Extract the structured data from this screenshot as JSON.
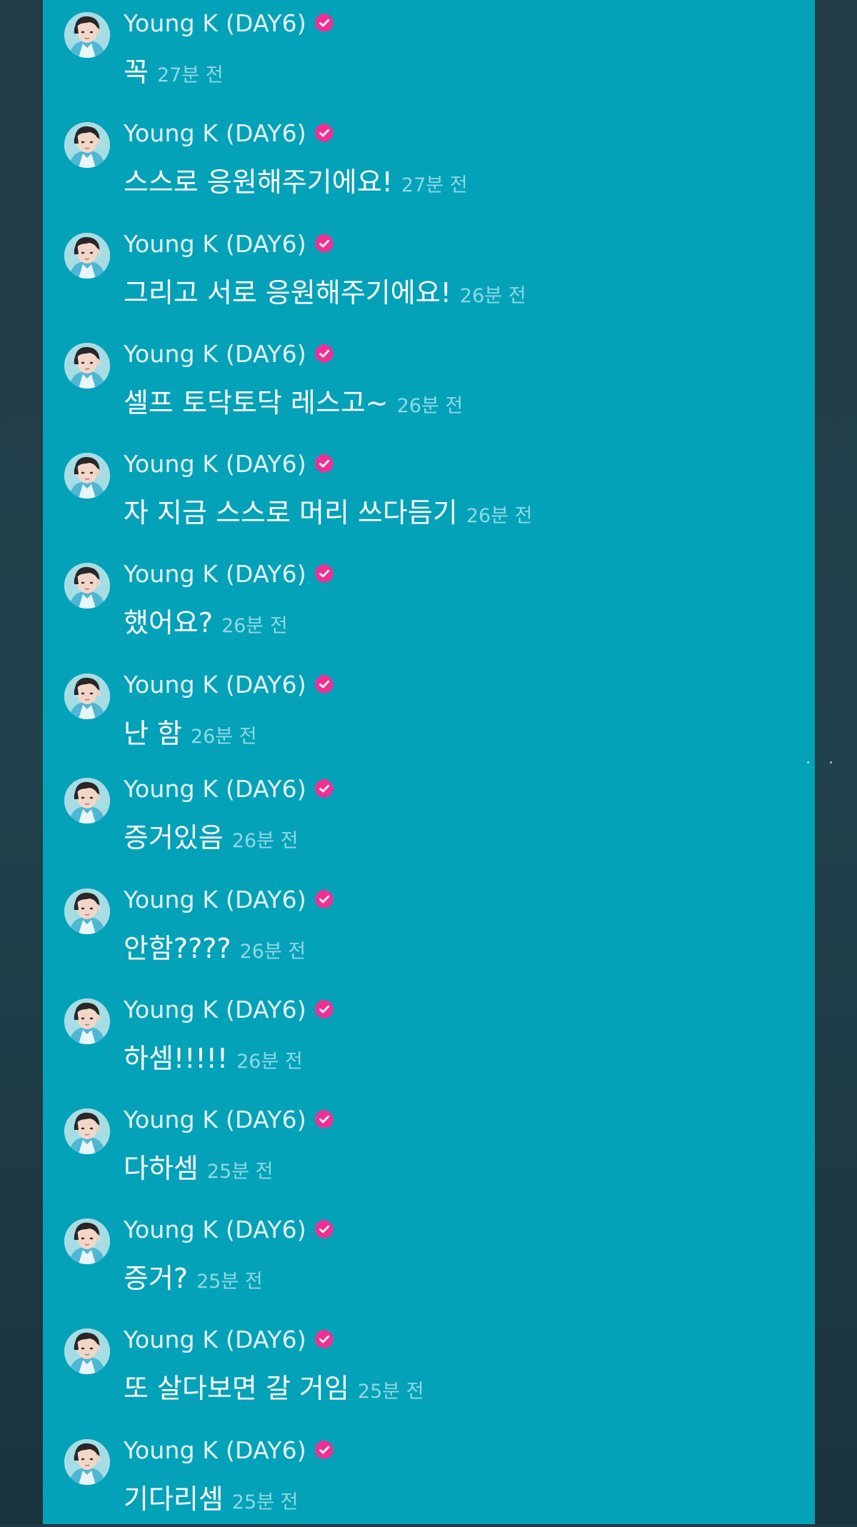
{
  "colors": {
    "panel": "#04a2b9",
    "badge": "#f12f93",
    "name_text": "#e3f4f7",
    "message_text": "#ffffff",
    "time_text": "#8fd8e3"
  },
  "badge_icon": "verified-check-icon",
  "messages": [
    {
      "name": "Young K (DAY6)",
      "text": "꼭",
      "time": "27분 전"
    },
    {
      "name": "Young K (DAY6)",
      "text": "스스로 응원해주기에요!",
      "time": "27분 전"
    },
    {
      "name": "Young K (DAY6)",
      "text": "그리고 서로 응원해주기에요!",
      "time": "26분 전"
    },
    {
      "name": "Young K (DAY6)",
      "text": "셀프 토닥토닥 레스고~",
      "time": "26분 전"
    },
    {
      "name": "Young K (DAY6)",
      "text": "자 지금 스스로 머리 쓰다듬기",
      "time": "26분 전"
    },
    {
      "name": "Young K (DAY6)",
      "text": "했어요?",
      "time": "26분 전"
    },
    {
      "name": "Young K (DAY6)",
      "text": "난 함",
      "time": "26분 전"
    },
    {
      "name": "Young K (DAY6)",
      "text": "증거있음",
      "time": "26분 전"
    },
    {
      "name": "Young K (DAY6)",
      "text": "안함????",
      "time": "26분 전"
    },
    {
      "name": "Young K (DAY6)",
      "text": "하셈!!!!!",
      "time": "26분 전"
    },
    {
      "name": "Young K (DAY6)",
      "text": "다하셈",
      "time": "25분 전"
    },
    {
      "name": "Young K (DAY6)",
      "text": "증거?",
      "time": "25분 전"
    },
    {
      "name": "Young K (DAY6)",
      "text": "또 살다보면 갈 거임",
      "time": "25분 전"
    },
    {
      "name": "Young K (DAY6)",
      "text": "기다리셈",
      "time": "25분 전"
    }
  ]
}
